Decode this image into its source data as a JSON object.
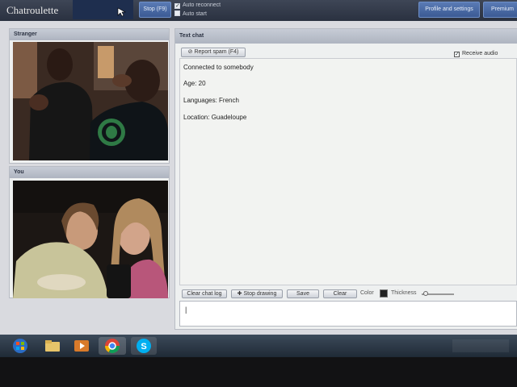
{
  "header": {
    "logo": "Chatroulette",
    "stop_button": "Stop (F9)",
    "auto_reconnect": "Auto reconnect",
    "auto_start": "Auto start",
    "profile_button": "Profile and settings",
    "premium_button": "Premium"
  },
  "stranger_panel": {
    "title": "Stranger"
  },
  "you_panel": {
    "title": "You"
  },
  "chat": {
    "title": "Text chat",
    "report_button": "Report spam (F4)",
    "receive_audio": "Receive audio",
    "messages": [
      "Connected to somebody",
      "Age: 20",
      "Languages: French",
      "Location: Guadeloupe"
    ],
    "tools": {
      "clear_log": "Clear chat log",
      "stop_drawing": "Stop drawing",
      "save": "Save",
      "clear": "Clear",
      "color_label": "Color",
      "thickness_label": "Thickness"
    },
    "input_value": "|"
  },
  "taskbar": {
    "icons": [
      "start-orb-icon",
      "folder-icon",
      "media-player-icon",
      "chrome-icon",
      "skype-icon"
    ]
  },
  "colors": {
    "topbar": "#2f3646",
    "accent_blue": "#4a6ba5",
    "panel_bg": "#eef0f0"
  }
}
